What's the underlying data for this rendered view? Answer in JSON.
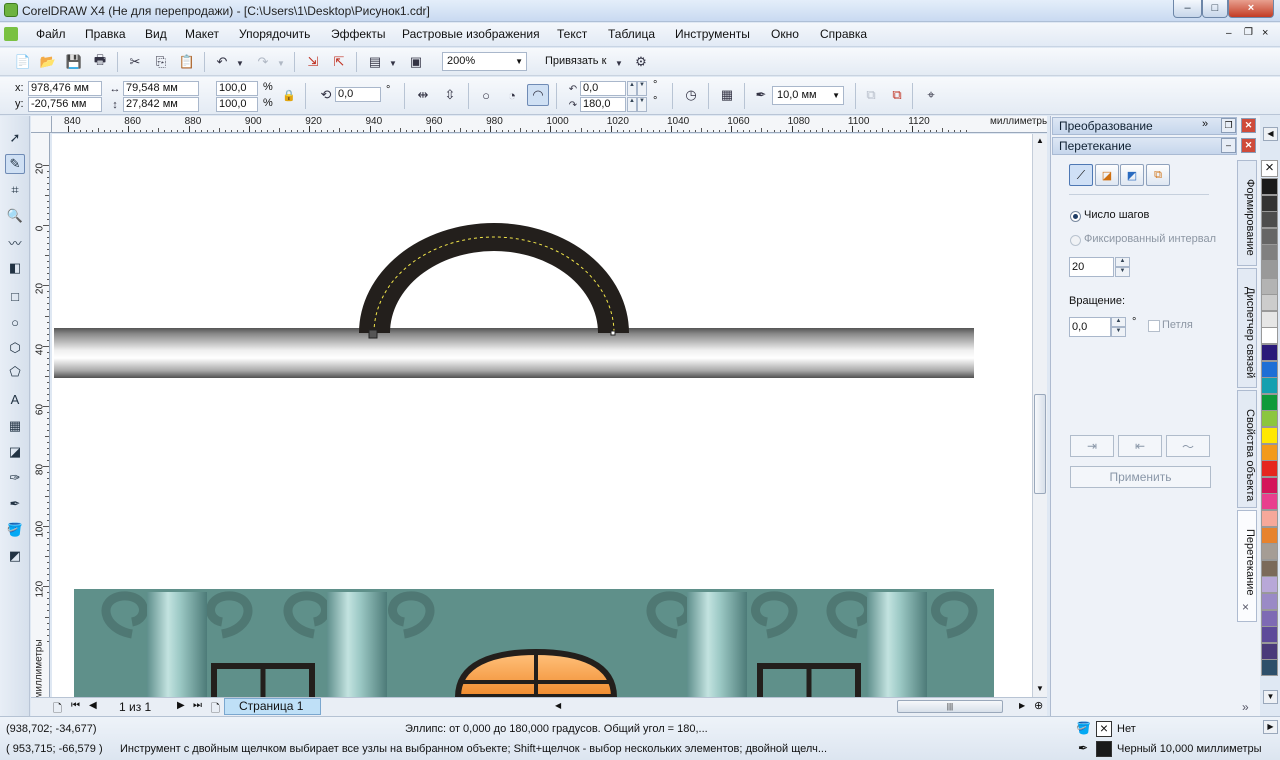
{
  "window": {
    "title": "CorelDRAW X4 (Не для перепродажи) - [C:\\Users\\1\\Desktop\\Рисунок1.cdr]",
    "controls": [
      "–",
      "□",
      "×"
    ]
  },
  "menu": [
    "Файл",
    "Правка",
    "Вид",
    "Макет",
    "Упорядочить",
    "Эффекты",
    "Растровые изображения",
    "Текст",
    "Таблица",
    "Инструменты",
    "Окно",
    "Справка"
  ],
  "toolbar": {
    "zoom": "200%",
    "snap_label": "Привязать к"
  },
  "propbar": {
    "x_label": "x:",
    "x_value": "978,476 мм",
    "y_label": "y:",
    "y_value": "-20,756 мм",
    "w_value": "79,548 мм",
    "h_value": "27,842 мм",
    "scale_x": "100,0",
    "scale_y": "100,0",
    "percent": "%",
    "rotation": "0,0",
    "degree": "°",
    "start_angle": "0,0",
    "end_angle": "180,0",
    "outline_width": "10,0 мм"
  },
  "ruler": {
    "h_ticks": [
      "840",
      "860",
      "880",
      "900",
      "920",
      "940",
      "960",
      "980",
      "1000",
      "1020",
      "1040",
      "1060",
      "1080",
      "1100",
      "1120"
    ],
    "h_unit": "миллиметры",
    "v_ticks": [
      "20",
      "0",
      "20",
      "40",
      "60",
      "80",
      "100",
      "120"
    ],
    "v_unit": "миллиметры"
  },
  "page_nav": {
    "count": "1 из 1",
    "tab": "Страница 1"
  },
  "docker": {
    "header1": "Преобразование",
    "header2": "Перетекание",
    "radio_steps": "Число шагов",
    "radio_fixed": "Фиксированный интервал",
    "steps_value": "20",
    "rotation_label": "Вращение:",
    "rotation_value": "0,0",
    "degree": "°",
    "loop_label": "Петля",
    "apply_button": "Применить"
  },
  "vertical_tabs": [
    "Формирование",
    "Диспетчер связей",
    "Свойства объекта",
    "Перетекание"
  ],
  "palette_colors": [
    "#1a1a1a",
    "#333333",
    "#4d4d4d",
    "#666666",
    "#808080",
    "#999999",
    "#b3b3b3",
    "#cccccc",
    "#e6e6e6",
    "#ffffff",
    "#2a1a7a",
    "#1d6fd6",
    "#14a0b0",
    "#0f9a3a",
    "#8bc63e",
    "#ffe800",
    "#f39a1a",
    "#e5261f",
    "#d4145a",
    "#e83f8e",
    "#f6a89a",
    "#e7832e",
    "#a59d95",
    "#7b6a5a",
    "#b8a8d8",
    "#9a8ac6",
    "#7e6ab4",
    "#5d4a9a",
    "#4a3a7a",
    "#2d4f6a"
  ],
  "status": {
    "cursor1": "(938,702; -34,677)",
    "cursor2": "( 953,715; -66,579 )",
    "object_info": "Эллипс: от 0,000 до 180,000 градусов.  Общий угол = 180,...",
    "hint": "Инструмент с двойным щелчком выбирает все узлы на выбранном объекте; Shift+щелчок - выбор нескольких элементов; двойной щелч...",
    "fill": "Нет",
    "outline": "Черный  10,000 миллиметры"
  }
}
